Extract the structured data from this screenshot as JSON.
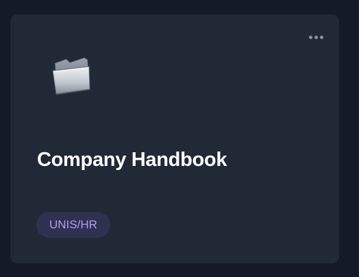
{
  "card": {
    "title": "Company Handbook",
    "tag": "UNIS/HR",
    "icon": "folder-icon",
    "menu_icon": "more-horizontal-icon"
  },
  "colors": {
    "background": "#141a28",
    "card": "#212836",
    "title": "#ffffff",
    "tag_text": "#b39df2",
    "tag_background": "#2f3150"
  }
}
